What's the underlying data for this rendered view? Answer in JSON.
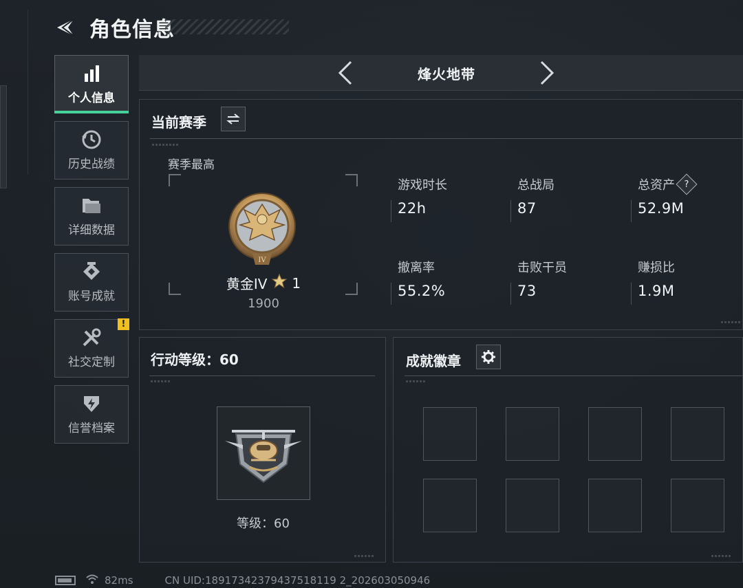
{
  "header": {
    "title": "角色信息"
  },
  "sidebar": {
    "items": [
      {
        "label": "个人信息",
        "icon": "bar-chart-icon",
        "active": true
      },
      {
        "label": "历史战绩",
        "icon": "history-clock-icon"
      },
      {
        "label": "详细数据",
        "icon": "folder-icon"
      },
      {
        "label": "账号成就",
        "icon": "achievement-diamond-icon"
      },
      {
        "label": "社交定制",
        "icon": "tools-icon",
        "badge": "!"
      },
      {
        "label": "信誉档案",
        "icon": "shield-bolt-icon"
      }
    ]
  },
  "mode_bar": {
    "name": "烽火地带"
  },
  "season_panel": {
    "title": "当前赛季",
    "best_label": "赛季最高",
    "rank_name": "黄金IV",
    "rank_stars": "1",
    "rank_points": "1900",
    "rank_emblem_numeral": "IV",
    "stats": [
      {
        "label": "游戏时长",
        "value": "22h"
      },
      {
        "label": "总战局",
        "value": "87"
      },
      {
        "label": "总资产",
        "value": "52.9M",
        "help": "?"
      },
      {
        "label": "撤离率",
        "value": "55.2%"
      },
      {
        "label": "击败干员",
        "value": "73"
      },
      {
        "label": "赚损比",
        "value": "1.9M"
      }
    ]
  },
  "level_panel": {
    "title": "行动等级：60",
    "level_text": "等级：60"
  },
  "badge_panel": {
    "title": "成就徽章"
  },
  "footer": {
    "ping": "82ms",
    "uid": "CN UID:18917342379437518119 2_202603050946"
  },
  "colors": {
    "accent": "#46d19a",
    "warning": "#f2c01e",
    "gold": "#c9a86a"
  }
}
